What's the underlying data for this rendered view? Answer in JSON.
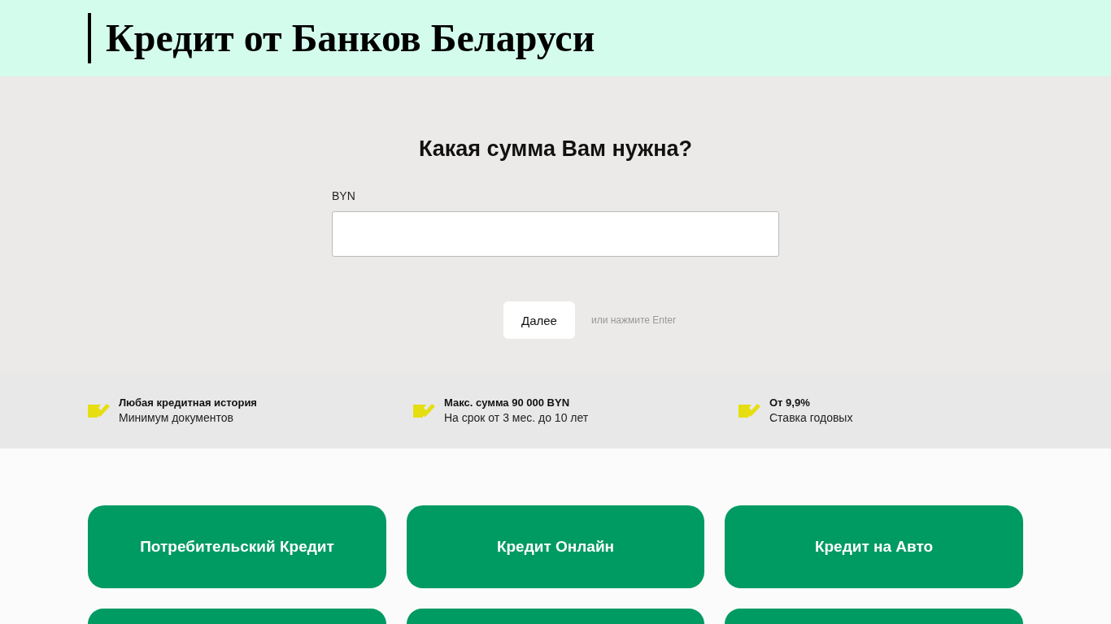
{
  "header": {
    "title": "Кредит от Банков Беларуси"
  },
  "form": {
    "question": "Какая сумма Вам нужна?",
    "field_label": "BYN",
    "next_button": "Далее",
    "hint": "или нажмите Enter"
  },
  "features": [
    {
      "title": "Любая кредитная история",
      "subtitle": "Минимум документов"
    },
    {
      "title": "Макс. сумма 90 000 BYN",
      "subtitle": "На срок от 3 мес. до 10 лет"
    },
    {
      "title": "От 9,9%",
      "subtitle": "Ставка годовых"
    }
  ],
  "categories": [
    {
      "label": "Потребительский Кредит"
    },
    {
      "label": "Кредит Онлайн"
    },
    {
      "label": "Кредит на Авто"
    }
  ]
}
